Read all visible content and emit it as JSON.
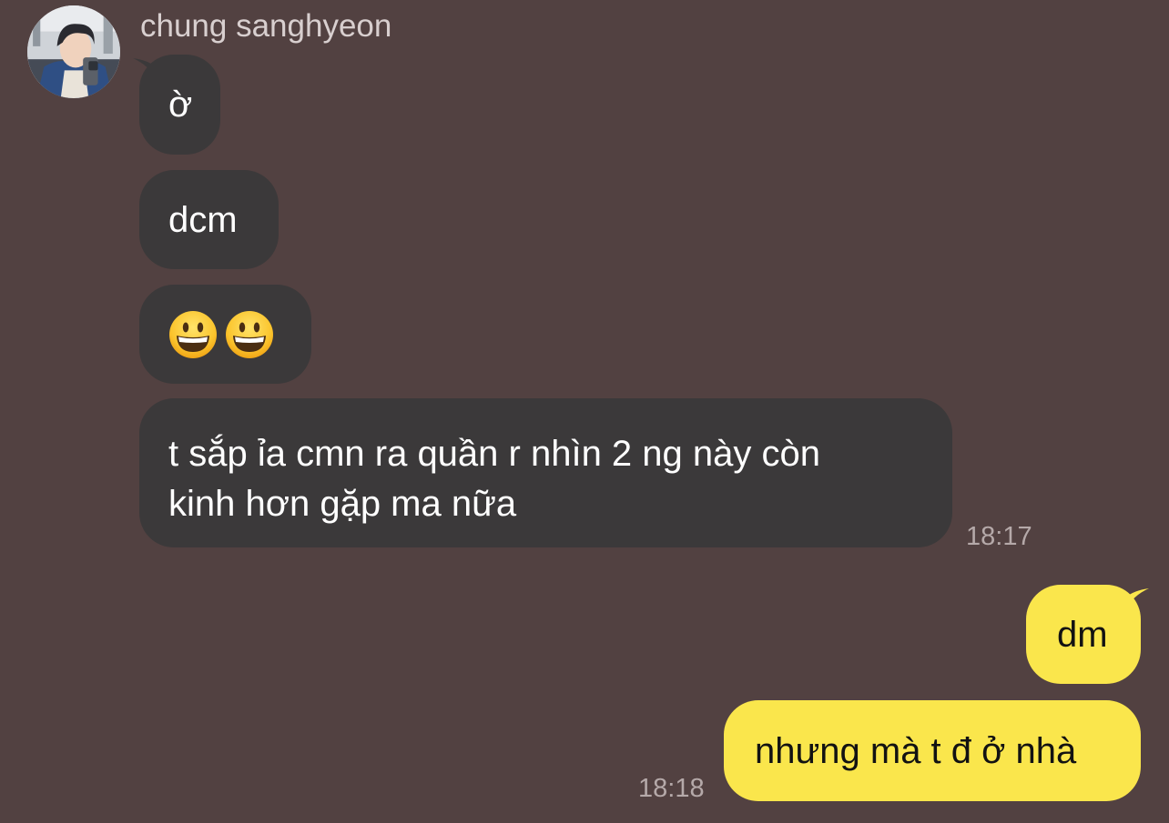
{
  "chat": {
    "sender": {
      "name": "chung sanghyeon",
      "avatar_icon": "profile-photo"
    },
    "incoming": [
      {
        "text": "ờ"
      },
      {
        "text": "dcm"
      },
      {
        "emoji": [
          "grinning-face",
          "grinning-face"
        ]
      },
      {
        "lines": [
          "t sắp ỉa cmn ra quần r nhìn 2 ng này còn",
          "kinh hơn gặp ma nữa"
        ]
      }
    ],
    "incoming_time": "18:17",
    "outgoing": [
      {
        "text": "dm"
      },
      {
        "text": "nhưng mà t đ ở nhà"
      }
    ],
    "outgoing_time": "18:18"
  },
  "colors": {
    "background": "#524141",
    "incoming_bubble": "#3b393a",
    "outgoing_bubble": "#fae64c",
    "incoming_text": "#ffffff",
    "outgoing_text": "#121212",
    "timestamp": "#b5a9a9"
  }
}
